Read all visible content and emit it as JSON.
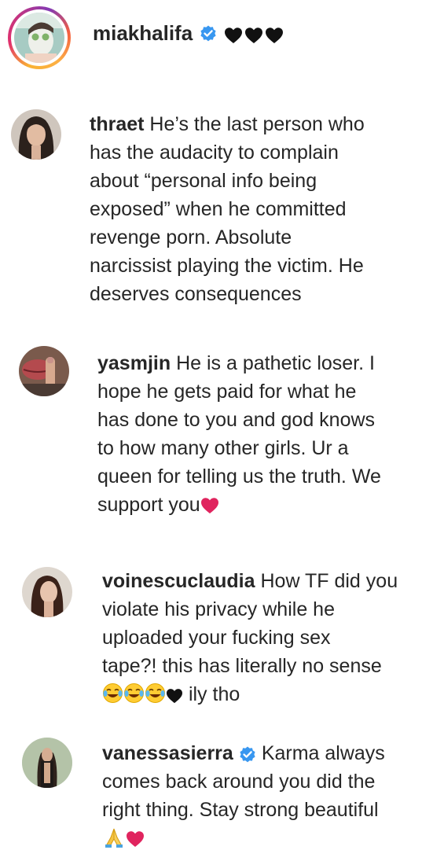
{
  "post_header": {
    "username": "miakhalifa",
    "verified_icon": "verified-badge-icon",
    "trailing_emoji": [
      "black-heart",
      "black-heart",
      "black-heart"
    ]
  },
  "colors": {
    "text": "#262626",
    "verified_blue": "#3897f0",
    "heart_red": "#e0245e",
    "story_ring": [
      "#f9b233",
      "#e1306c",
      "#833ab4"
    ]
  },
  "comments": [
    {
      "username": "thraet",
      "verified": false,
      "lines": [
        "He’s the last person who",
        "has the audacity to complain",
        "about “personal info being",
        "exposed” when he committed",
        "revenge porn. Absolute",
        "narcissist playing the victim. He",
        "deserves consequences"
      ]
    },
    {
      "username": "yasmjin",
      "verified": false,
      "lines": [
        "He is a pathetic loser. I",
        "hope he gets paid for what he",
        "has done to you and god knows",
        "to how many other girls. Ur a",
        "queen for telling us the truth. We",
        "support you"
      ],
      "trailing_emoji": [
        "red-heart"
      ]
    },
    {
      "username": "voinescuclaudia",
      "verified": false,
      "lines": [
        "How TF did you",
        "violate his privacy while he",
        "uploaded your fucking sex",
        "tape?! this has literally no sense",
        "ily tho"
      ],
      "emoji_before_last_line": [
        "tears-of-joy",
        "tears-of-joy",
        "tears-of-joy",
        "black-heart"
      ]
    },
    {
      "username": "vanessasierra",
      "verified": true,
      "lines": [
        "Karma always",
        "comes back around you did the",
        "right thing. Stay strong beautiful"
      ],
      "emoji_last_line": [
        "folded-hands",
        "red-heart"
      ]
    }
  ]
}
